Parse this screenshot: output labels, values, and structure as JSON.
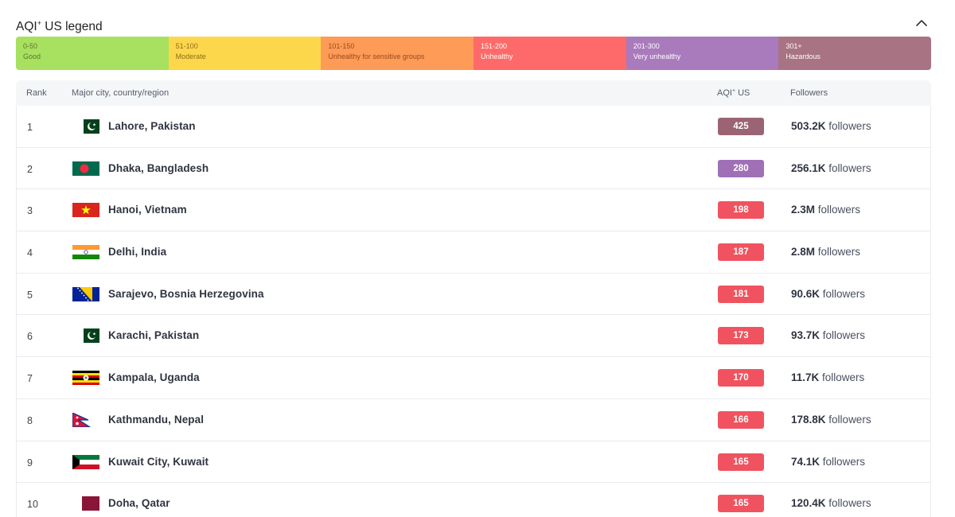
{
  "legend": {
    "title": "AQI",
    "title_sup": "+",
    "title_suffix": " US legend",
    "segments": [
      {
        "range": "0-50",
        "label": "Good",
        "color": "#a8e05f",
        "text_color": "#607631"
      },
      {
        "range": "51-100",
        "label": "Moderate",
        "color": "#fdd74b",
        "text_color": "#8c6c1d"
      },
      {
        "range": "101-150",
        "label": "Unhealthy for sensitive groups",
        "color": "#fe9b57",
        "text_color": "#974a20"
      },
      {
        "range": "151-200",
        "label": "Unhealthy",
        "color": "#fe6a69",
        "text_color": "#ffffff"
      },
      {
        "range": "201-300",
        "label": "Very unhealthy",
        "color": "#a97abc",
        "text_color": "#ffffff"
      },
      {
        "range": "301+",
        "label": "Hazardous",
        "color": "#a87383",
        "text_color": "#ffffff"
      }
    ]
  },
  "table": {
    "headers": {
      "rank": "Rank",
      "city": "Major city, country/region",
      "aqi": "AQI",
      "aqi_sup": "+",
      "aqi_suffix": " US",
      "followers": "Followers"
    },
    "rows": [
      {
        "rank": "1",
        "city": "Lahore, Pakistan",
        "flag": "pakistan",
        "aqi": "425",
        "aqi_color": "#9a6474",
        "followers_count": "503.2K",
        "followers_suffix": " followers"
      },
      {
        "rank": "2",
        "city": "Dhaka, Bangladesh",
        "flag": "bangladesh",
        "aqi": "280",
        "aqi_color": "#a070b6",
        "followers_count": "256.1K",
        "followers_suffix": " followers"
      },
      {
        "rank": "3",
        "city": "Hanoi, Vietnam",
        "flag": "vietnam",
        "aqi": "198",
        "aqi_color": "#f0535f",
        "followers_count": "2.3M",
        "followers_suffix": " followers"
      },
      {
        "rank": "4",
        "city": "Delhi, India",
        "flag": "india",
        "aqi": "187",
        "aqi_color": "#f0535f",
        "followers_count": "2.8M",
        "followers_suffix": " followers"
      },
      {
        "rank": "5",
        "city": "Sarajevo, Bosnia Herzegovina",
        "flag": "bosnia",
        "aqi": "181",
        "aqi_color": "#f0535f",
        "followers_count": "90.6K",
        "followers_suffix": " followers"
      },
      {
        "rank": "6",
        "city": "Karachi, Pakistan",
        "flag": "pakistan",
        "aqi": "173",
        "aqi_color": "#f0535f",
        "followers_count": "93.7K",
        "followers_suffix": " followers"
      },
      {
        "rank": "7",
        "city": "Kampala, Uganda",
        "flag": "uganda",
        "aqi": "170",
        "aqi_color": "#f0535f",
        "followers_count": "11.7K",
        "followers_suffix": " followers"
      },
      {
        "rank": "8",
        "city": "Kathmandu, Nepal",
        "flag": "nepal",
        "aqi": "166",
        "aqi_color": "#f0535f",
        "followers_count": "178.8K",
        "followers_suffix": " followers"
      },
      {
        "rank": "9",
        "city": "Kuwait City, Kuwait",
        "flag": "kuwait",
        "aqi": "165",
        "aqi_color": "#f0535f",
        "followers_count": "74.1K",
        "followers_suffix": " followers"
      },
      {
        "rank": "10",
        "city": "Doha, Qatar",
        "flag": "qatar",
        "aqi": "165",
        "aqi_color": "#f0535f",
        "followers_count": "120.4K",
        "followers_suffix": " followers"
      }
    ]
  }
}
